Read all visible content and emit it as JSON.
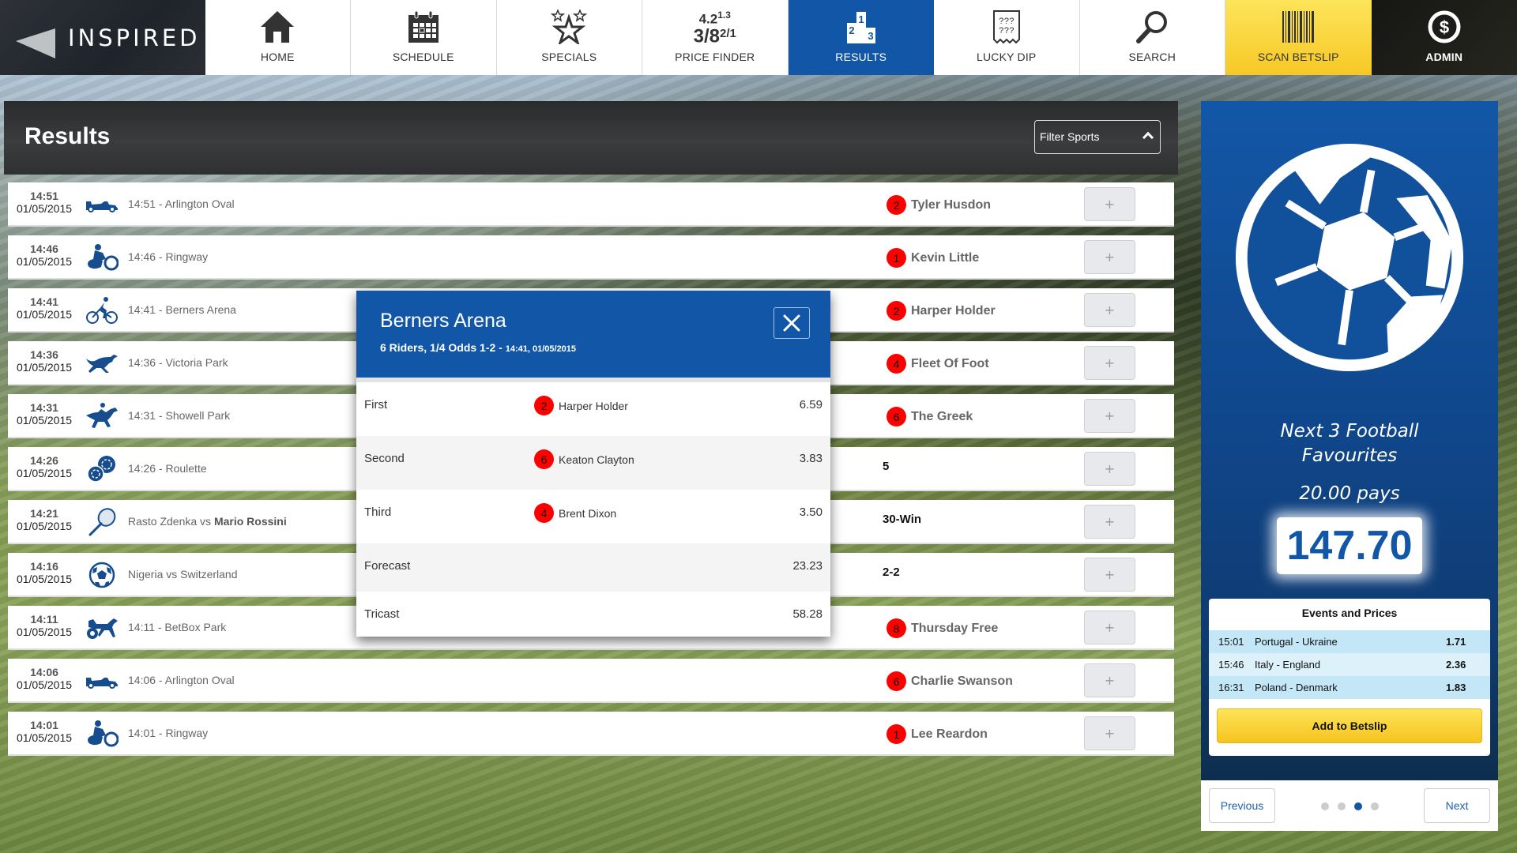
{
  "header": {
    "logo_text": "INSPIRED",
    "tabs": [
      {
        "label": "HOME",
        "icon": "home-icon"
      },
      {
        "label": "SCHEDULE",
        "icon": "calendar-icon"
      },
      {
        "label": "SPECIALS",
        "icon": "stars-icon"
      },
      {
        "label": "PRICE FINDER",
        "icon": "odds-icon",
        "icon_text_top": "4.2",
        "icon_sup_top": "1.3",
        "icon_text_bottom": "3/8",
        "icon_sup_bottom": "2/1"
      },
      {
        "label": "RESULTS",
        "icon": "podium-icon",
        "active": true
      },
      {
        "label": "LUCKY DIP",
        "icon": "ticket-icon"
      },
      {
        "label": "SEARCH",
        "icon": "search-icon"
      },
      {
        "label": "SCAN BETSLIP",
        "icon": "barcode-icon"
      },
      {
        "label": "ADMIN",
        "icon": "dollar-icon"
      }
    ]
  },
  "results": {
    "title": "Results",
    "filter_label": "Filter Sports",
    "plus_label": "+",
    "rows": [
      {
        "time": "14:51",
        "date": "01/05/2015",
        "sport": "motor-racing",
        "event": "14:51  -  Arlington Oval",
        "badge": "2",
        "result": "Tyler Husdon"
      },
      {
        "time": "14:46",
        "date": "01/05/2015",
        "sport": "speedway",
        "event": "14:46  -  Ringway",
        "badge": "1",
        "result": "Kevin Little"
      },
      {
        "time": "14:41",
        "date": "01/05/2015",
        "sport": "cycling",
        "event": "14:41  -  Berners Arena",
        "badge": "2",
        "result": "Harper Holder"
      },
      {
        "time": "14:36",
        "date": "01/05/2015",
        "sport": "greyhound",
        "event": "14:36  -  Victoria Park",
        "badge": "4",
        "result": "Fleet Of Foot"
      },
      {
        "time": "14:31",
        "date": "01/05/2015",
        "sport": "horse-racing",
        "event": "14:31  -  Showell Park",
        "badge": "6",
        "result": "The Greek"
      },
      {
        "time": "14:26",
        "date": "01/05/2015",
        "sport": "roulette",
        "event": "14:26  -  Roulette",
        "badge": null,
        "result": "5"
      },
      {
        "time": "14:21",
        "date": "01/05/2015",
        "sport": "tennis",
        "event": "Rasto Zdenka vs ",
        "event_bold": "Mario Rossini",
        "badge": null,
        "result": "30-Win"
      },
      {
        "time": "14:16",
        "date": "01/05/2015",
        "sport": "football",
        "event": "Nigeria vs Switzerland",
        "badge": null,
        "result": "2-2"
      },
      {
        "time": "14:11",
        "date": "01/05/2015",
        "sport": "harness-racing",
        "event": "14:11  -  BetBox Park",
        "badge": "8",
        "result": "Thursday Free"
      },
      {
        "time": "14:06",
        "date": "01/05/2015",
        "sport": "motor-racing",
        "event": "14:06  -  Arlington Oval",
        "badge": "6",
        "result": "Charlie Swanson"
      },
      {
        "time": "14:01",
        "date": "01/05/2015",
        "sport": "speedway",
        "event": "14:01  -  Ringway",
        "badge": "1",
        "result": "Lee Reardon"
      }
    ]
  },
  "popup": {
    "title": "Berners Arena",
    "subtitle": "6 Riders, 1/4 Odds 1-2 - ",
    "subtitle_small": "14:41, 01/05/2015",
    "rows": [
      {
        "label": "First",
        "badge": "2",
        "name": "Harper Holder",
        "value": "6.59"
      },
      {
        "label": "Second",
        "badge": "6",
        "name": "Keaton Clayton",
        "value": "3.83"
      },
      {
        "label": "Third",
        "badge": "4",
        "name": "Brent Dixon",
        "value": "3.50"
      },
      {
        "label": "Forecast",
        "badge": null,
        "name": "",
        "value": "23.23"
      },
      {
        "label": "Tricast",
        "badge": null,
        "name": "",
        "value": "58.28"
      }
    ]
  },
  "promo": {
    "title_line1": "Next 3 Football",
    "title_line2": "Favourites",
    "pays": "20.00 pays",
    "amount": "147.70",
    "events_title": "Events and Prices",
    "events": [
      {
        "time": "15:01",
        "match": "Portugal - Ukraine",
        "price": "1.71"
      },
      {
        "time": "15:46",
        "match": "Italy - England",
        "price": "2.36"
      },
      {
        "time": "16:31",
        "match": "Poland - Denmark",
        "price": "1.83"
      }
    ],
    "add_button": "Add to Betslip",
    "previous": "Previous",
    "next": "Next",
    "carousel": {
      "pages": 4,
      "current": 3
    }
  },
  "colors": {
    "brand_blue": "#1257a7",
    "scan_yellow": "#f6c825",
    "badge_red": "#ff0000"
  }
}
